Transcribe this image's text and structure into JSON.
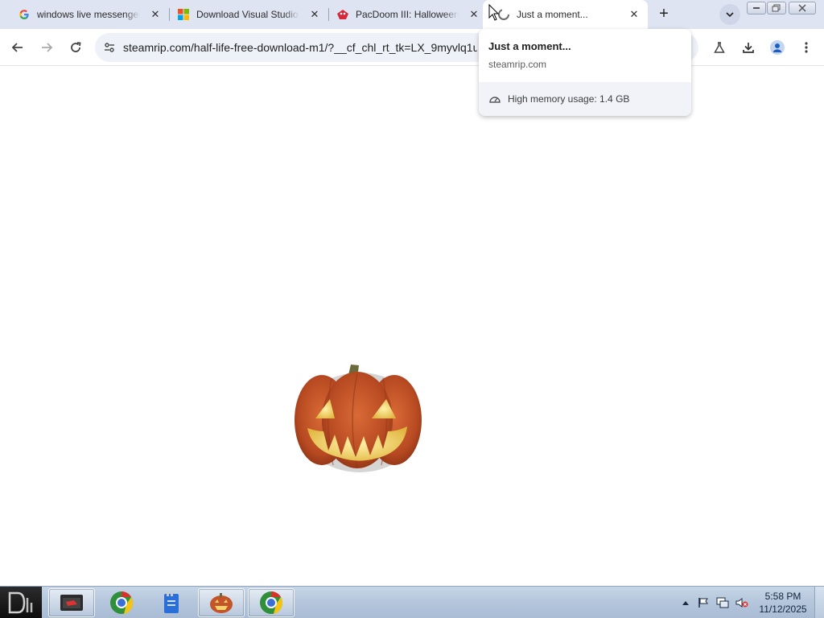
{
  "browser": {
    "tabs": [
      {
        "title": "windows live messenger",
        "favicon": "google-icon"
      },
      {
        "title": "Download Visual Studio",
        "favicon": "microsoft-icon"
      },
      {
        "title": "PacDoom III: Halloween",
        "favicon": "pacdoom-icon"
      },
      {
        "title": "Just a moment...",
        "favicon": "loading-icon",
        "active": true
      }
    ],
    "address_bar": {
      "url": "steamrip.com/half-life-free-download-m1/?__cf_chl_rt_tk=LX_9myvlq1u"
    },
    "hover_card": {
      "title": "Just a moment...",
      "domain": "steamrip.com",
      "memory": "High memory usage: 1.4 GB"
    }
  },
  "taskbar": {
    "apps": [
      "start-orb",
      "folder-app",
      "chrome-app",
      "notepad-app",
      "pumpkin-app",
      "chrome-app-active"
    ],
    "clock": {
      "time": "5:58 PM",
      "date": "11/12/2025"
    }
  },
  "colors": {
    "tabstrip": "#dee4f2",
    "omnibox": "#eef1f7",
    "pumpkin": "#c4542a",
    "taskbar": "#b4c6dc"
  }
}
